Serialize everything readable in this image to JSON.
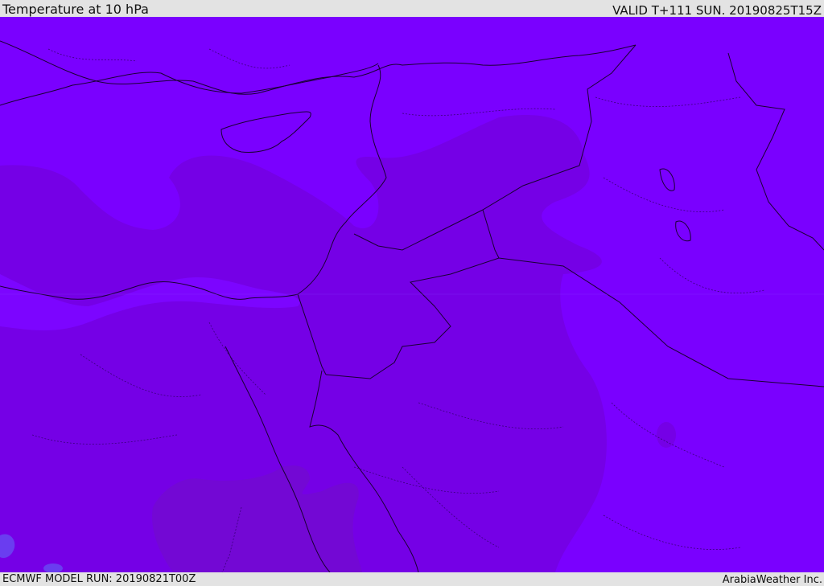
{
  "header": {
    "title": "Temperature at 10 hPa",
    "valid": "VALID T+111 SUN. 20190825T15Z"
  },
  "footer": {
    "model_run": "ECMWF MODEL RUN: 20190821T00Z",
    "brand": "ArabiaWeather Inc."
  },
  "map": {
    "fill_colors": {
      "base": "#7a00ff",
      "mid": "#7500e6",
      "dark": "#7308d4",
      "cool_spot": "#6a3df0",
      "sea": "#7c05ff"
    },
    "line_colors": {
      "coast": "#1a0033",
      "border": "#1a0033",
      "province": "#3a007a"
    }
  }
}
